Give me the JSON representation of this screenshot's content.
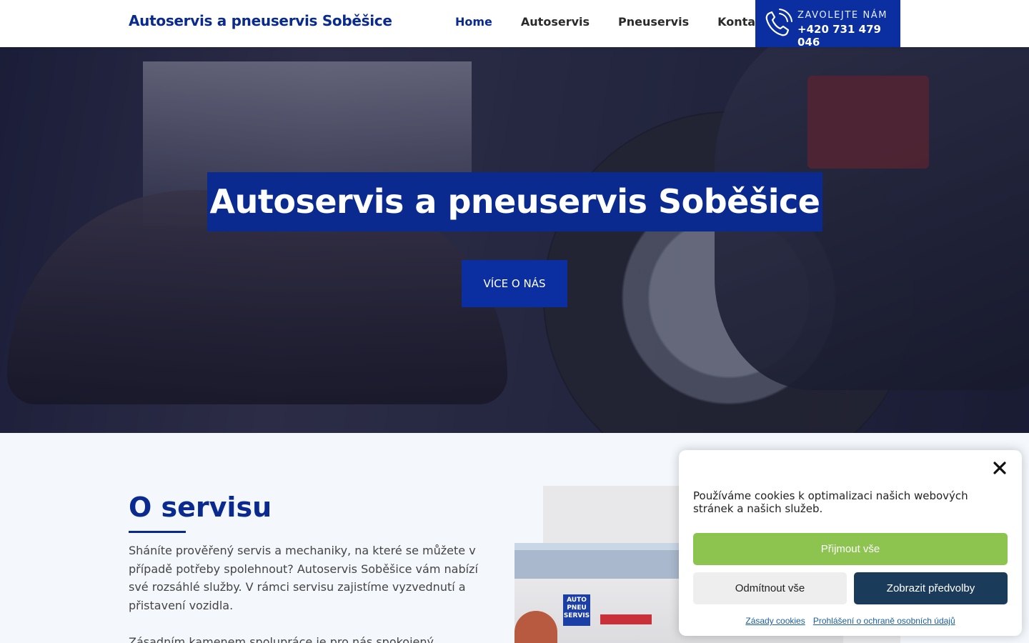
{
  "header": {
    "brand": "Autoservis a pneuservis Soběšice",
    "nav": [
      {
        "label": "Home"
      },
      {
        "label": "Autoservis"
      },
      {
        "label": "Pneuservis"
      },
      {
        "label": "Kontakt"
      }
    ],
    "call": {
      "label": "ZAVOLEJTE NÁM",
      "number": "+420 731 479 046",
      "icon": "phone-icon"
    }
  },
  "hero": {
    "title": "Autoservis a pneuservis Soběšice",
    "button": "VÍCE O NÁS"
  },
  "about": {
    "title": "O servisu",
    "p1": "Sháníte prověřený servis a mechaniky, na které se můžete v případě potřeby spolehnout? Autoservis Soběšice vám nabízí své rozsáhlé služby. V rámci servisu zajistíme vyzvednutí a přistavení vozidla.",
    "p2": "Zásadním kamenem spolupráce je pro nás spokojený zákazník",
    "photo_sign": "AUTO PNEU SERVIS"
  },
  "cookie": {
    "message": "Používáme cookies k optimalizaci našich webových stránek a našich služeb.",
    "accept": "Přijmout vše",
    "deny": "Odmítnout vše",
    "prefs": "Zobrazit předvolby",
    "link1": "Zásady cookies",
    "link2": "Prohlášení o ochraně osobních údajů"
  },
  "colors": {
    "brand": "#0a2a8f",
    "accent": "#0b2fa0",
    "accept": "#8cc44f",
    "prefs": "#1b3b5a"
  }
}
